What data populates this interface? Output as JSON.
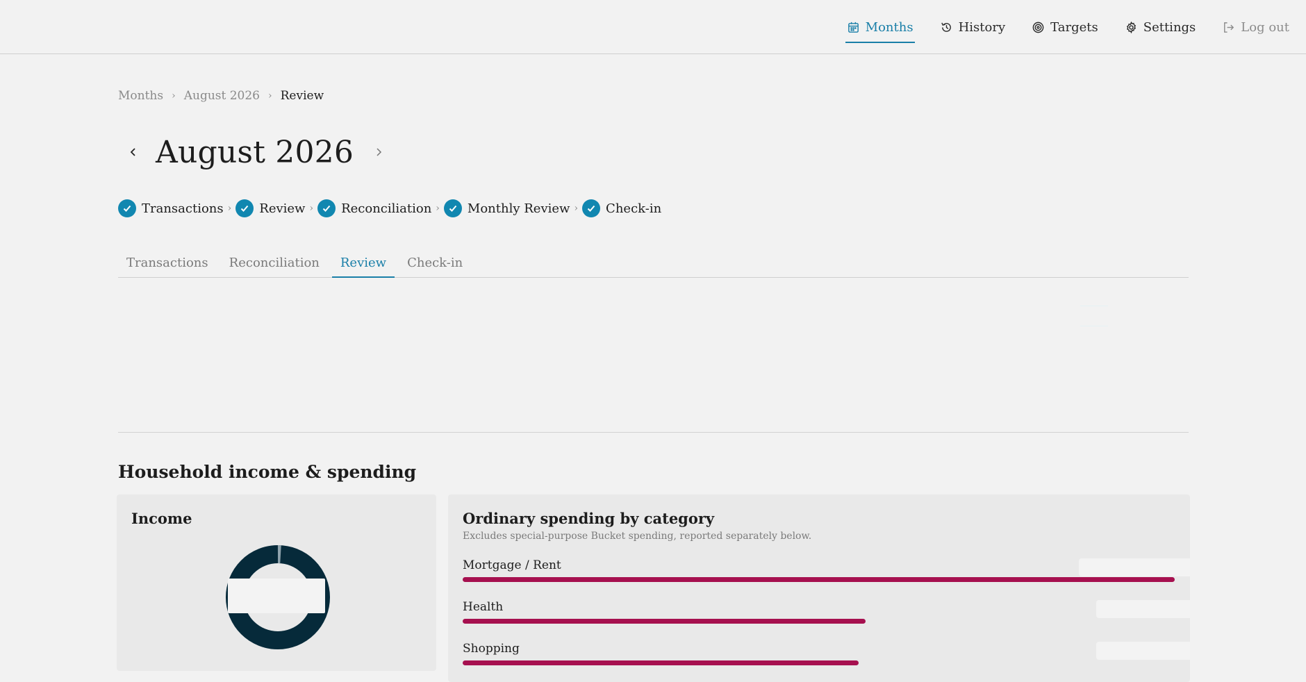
{
  "nav": {
    "items": [
      {
        "label": "Months",
        "icon": "calendar-icon",
        "active": true
      },
      {
        "label": "History",
        "icon": "history-icon",
        "active": false
      },
      {
        "label": "Targets",
        "icon": "target-icon",
        "active": false
      },
      {
        "label": "Settings",
        "icon": "gear-icon",
        "active": false
      }
    ],
    "logout": {
      "label": "Log out",
      "icon": "logout-icon"
    }
  },
  "breadcrumb": [
    "Months",
    "August 2026",
    "Review"
  ],
  "month": {
    "title": "August 2026"
  },
  "steps": [
    "Transactions",
    "Review",
    "Reconciliation",
    "Monthly Review",
    "Check-in"
  ],
  "tabs": [
    {
      "label": "Transactions",
      "active": false
    },
    {
      "label": "Reconciliation",
      "active": false
    },
    {
      "label": "Review",
      "active": true
    },
    {
      "label": "Check-in",
      "active": false
    }
  ],
  "section": {
    "title": "Household income & spending"
  },
  "income": {
    "title": "Income"
  },
  "spending": {
    "title": "Ordinary spending by category",
    "subtitle": "Excludes special-purpose Bucket spending, reported separately below.",
    "categories": [
      {
        "label": "Mortgage / Rent",
        "fraction": 1.0
      },
      {
        "label": "Health",
        "fraction": 0.566
      },
      {
        "label": "Shopping",
        "fraction": 0.556
      }
    ]
  },
  "colors": {
    "accent": "#1a7fa8",
    "check": "#1187b0",
    "bar": "#a6104f",
    "donut": "#062a3a",
    "donut_minor": "#8fa3ad"
  }
}
